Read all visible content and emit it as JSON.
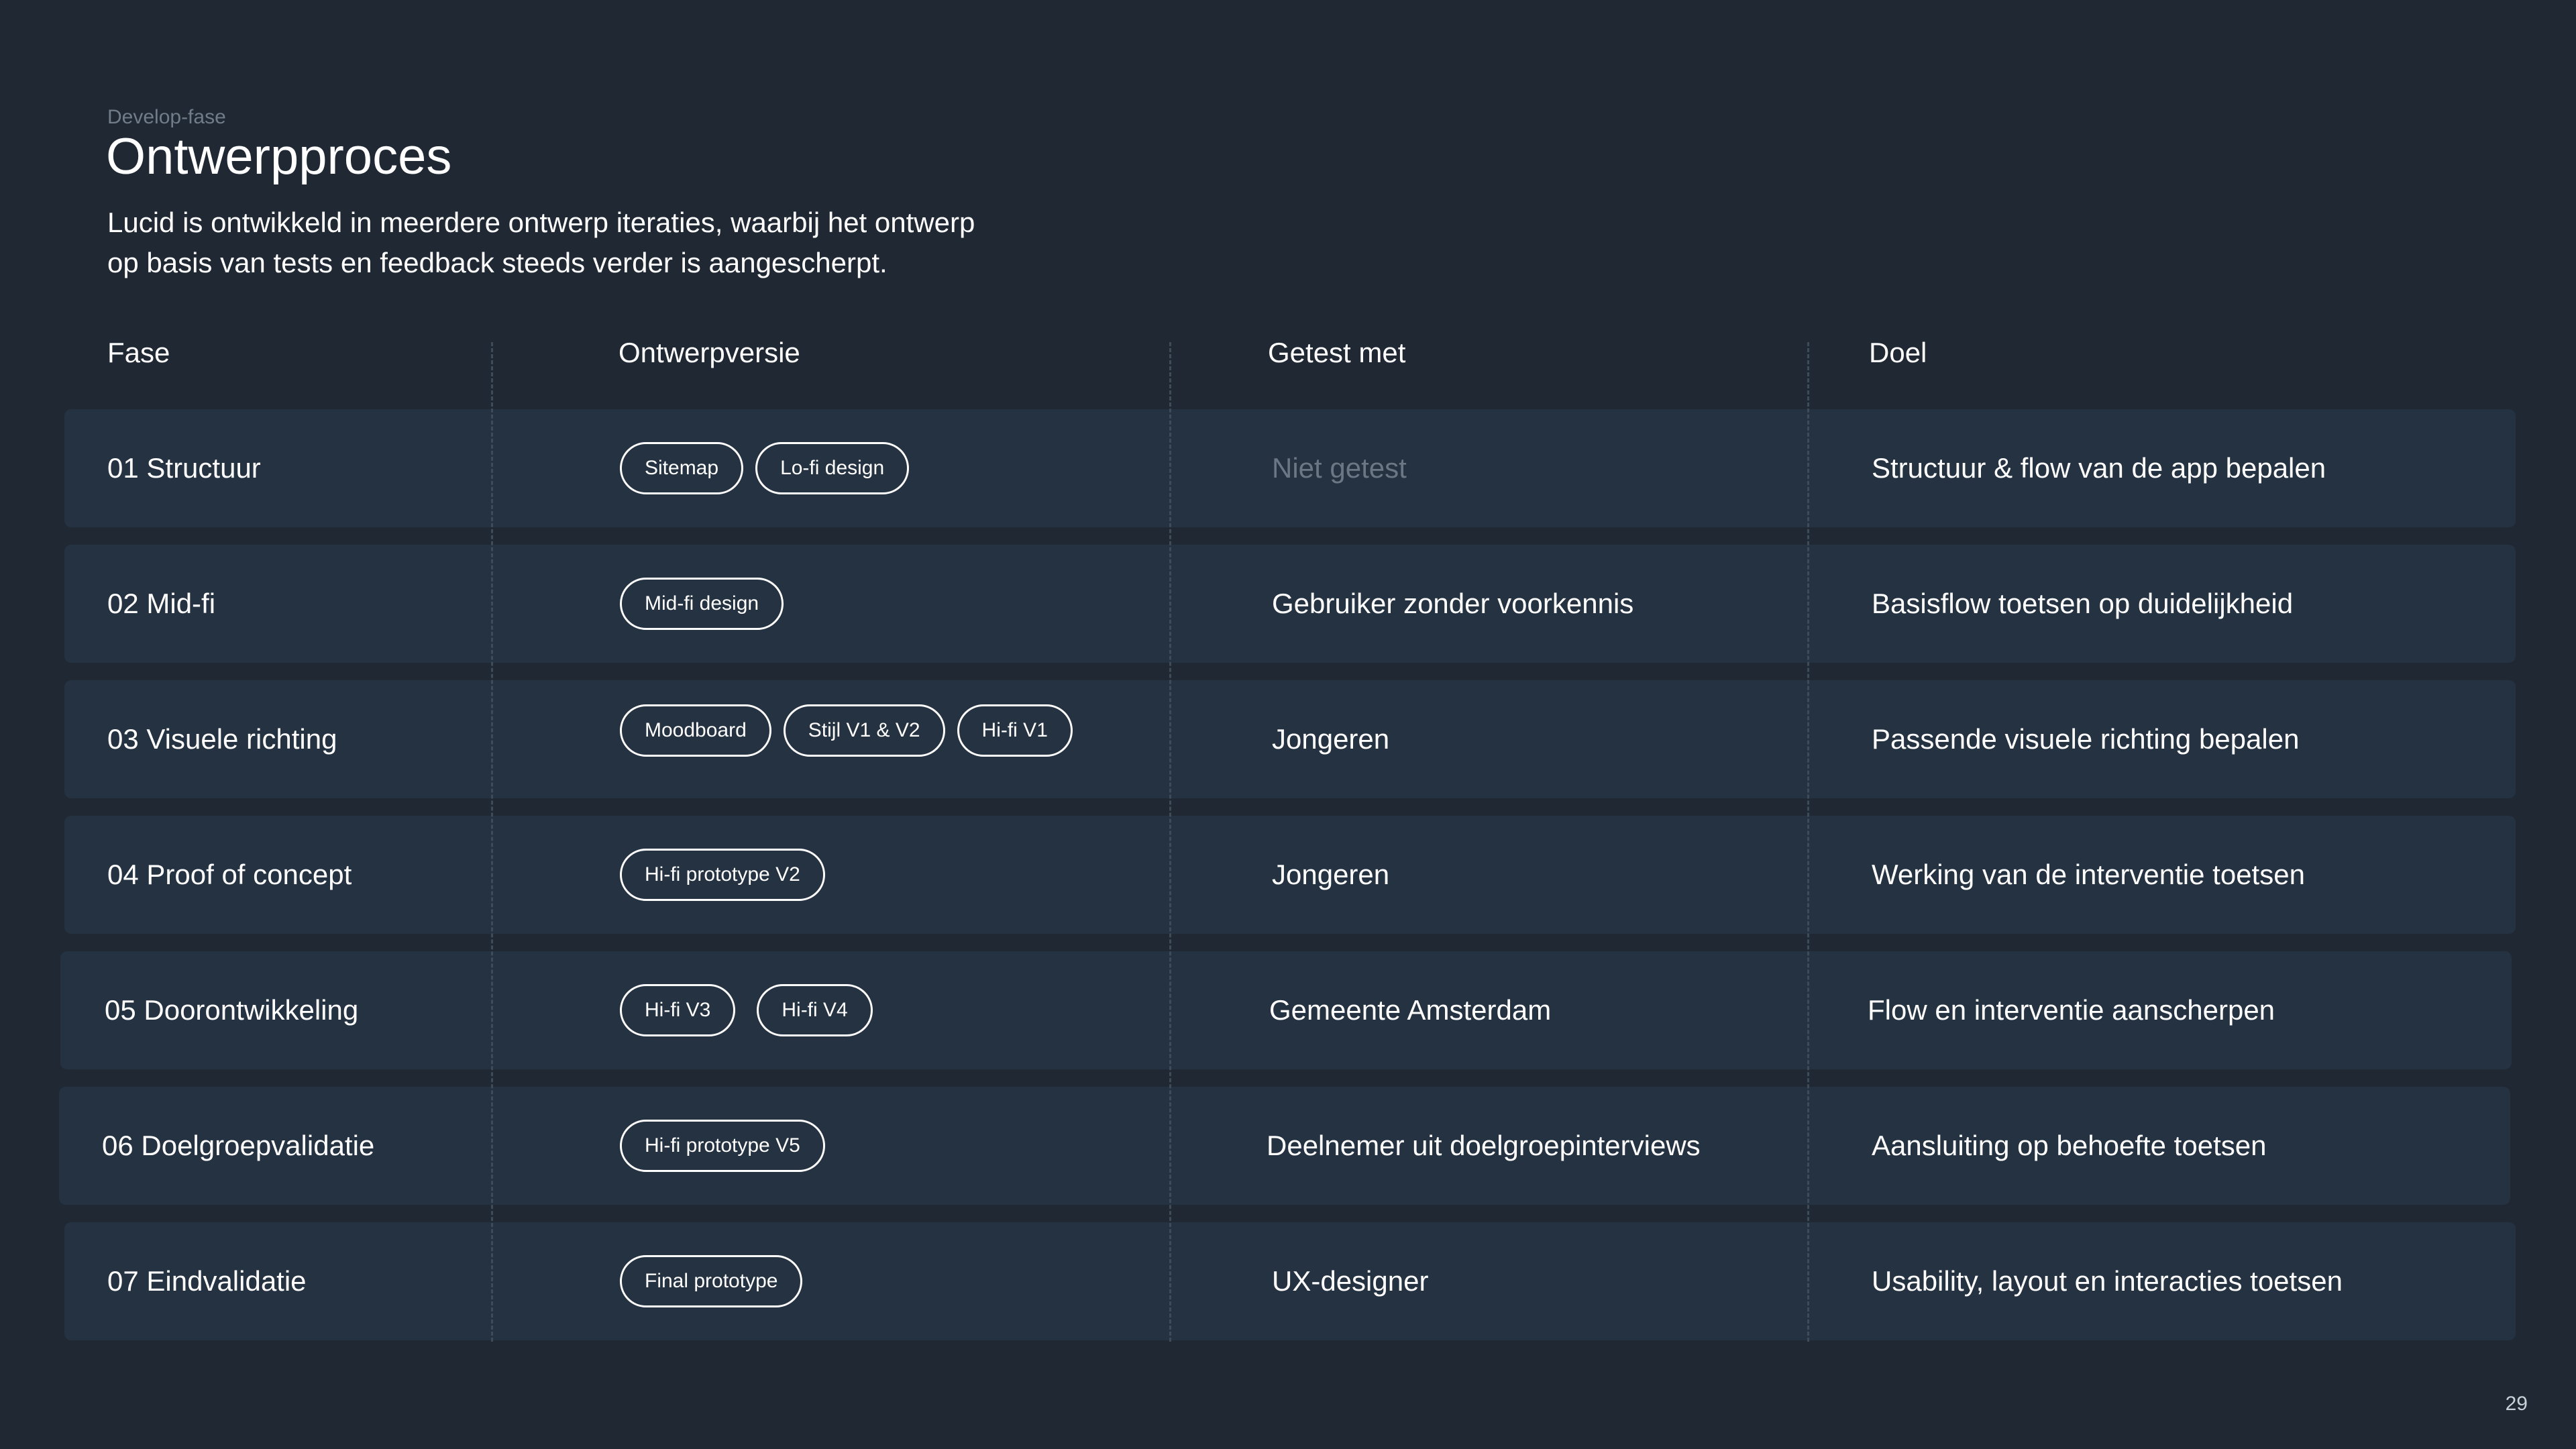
{
  "header": {
    "eyebrow": "Develop-fase",
    "title": "Ontwerpproces",
    "intro_line1": "Lucid is ontwikkeld in meerdere ontwerp iteraties, waarbij het ontwerp",
    "intro_line2": "op basis van tests en feedback steeds verder is aangescherpt."
  },
  "table": {
    "headers": {
      "fase": "Fase",
      "ontwerpversie": "Ontwerpversie",
      "getest_met": "Getest met",
      "doel": "Doel"
    },
    "rows": [
      {
        "fase": "01 Structuur",
        "versies": [
          "Sitemap",
          "Lo-fi design"
        ],
        "getest_met": "Niet getest",
        "doel": "Structuur & flow van de app bepalen"
      },
      {
        "fase": "02 Mid-fi",
        "versies": [
          "Mid-fi design"
        ],
        "getest_met": "Gebruiker zonder voorkennis",
        "doel": "Basisflow toetsen op duidelijkheid"
      },
      {
        "fase": "03 Visuele richting",
        "versies": [
          "Moodboard",
          "Stijl V1 & V2",
          "Hi-fi V1"
        ],
        "getest_met": "Jongeren",
        "doel": "Passende visuele richting bepalen"
      },
      {
        "fase": "04 Proof of concept",
        "versies": [
          "Hi-fi prototype V2"
        ],
        "getest_met": "Jongeren",
        "doel": "Werking van de interventie toetsen"
      },
      {
        "fase": "05 Doorontwikkeling",
        "versies": [
          "Hi-fi V3",
          "Hi-fi V4"
        ],
        "getest_met": "Gemeente Amsterdam",
        "doel": "Flow en interventie aanscherpen"
      },
      {
        "fase": "06 Doelgroepvalidatie",
        "versies": [
          "Hi-fi prototype V5"
        ],
        "getest_met": "Deelnemer uit doelgroepinterviews",
        "doel": "Aansluiting op behoefte toetsen"
      },
      {
        "fase": "07 Eindvalidatie",
        "versies": [
          "Final prototype"
        ],
        "getest_met": "UX-designer",
        "doel": "Usability, layout en interacties toetsen"
      }
    ]
  },
  "footer": {
    "page_number": "29"
  },
  "colors": {
    "background": "#1f2833",
    "row_background": "#253241",
    "muted_text": "#6b7784",
    "divider": "#3e4b59"
  }
}
